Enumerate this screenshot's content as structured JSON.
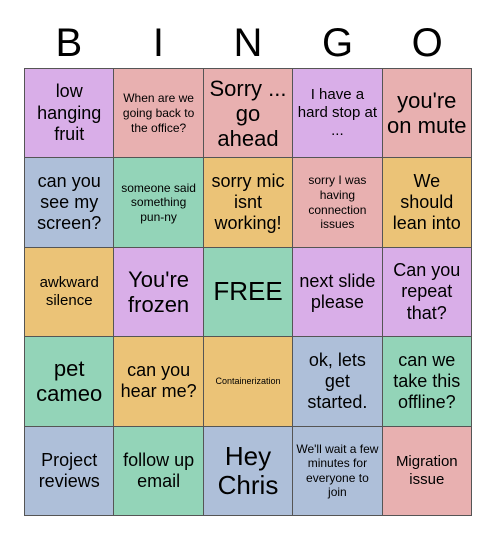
{
  "card": {
    "title_letters": [
      "B",
      "I",
      "N",
      "G",
      "O"
    ],
    "palette": {
      "purple": "#d9aee8",
      "pink": "#e8b0b0",
      "blue": "#aebfd9",
      "green": "#93d4b8",
      "orange": "#ebc377",
      "border": "#555555",
      "background": "#ffffff",
      "text": "#000000"
    },
    "columns": 5,
    "rows": 5,
    "cells": [
      {
        "text": "low hanging fruit",
        "color": "purple",
        "size": "lg"
      },
      {
        "text": "When are we going back to the office?",
        "color": "pink",
        "size": "sm"
      },
      {
        "text": "Sorry ... go ahead",
        "color": "pink",
        "size": "xl"
      },
      {
        "text": "I have a hard stop at ...",
        "color": "purple",
        "size": "md"
      },
      {
        "text": "you're on mute",
        "color": "pink",
        "size": "xl"
      },
      {
        "text": "can you see my screen?",
        "color": "blue",
        "size": "lg"
      },
      {
        "text": "someone said something pun-ny",
        "color": "green",
        "size": "sm"
      },
      {
        "text": "sorry mic isnt working!",
        "color": "orange",
        "size": "lg"
      },
      {
        "text": "sorry I was having connection issues",
        "color": "pink",
        "size": "sm"
      },
      {
        "text": "We should lean into",
        "color": "orange",
        "size": "lg"
      },
      {
        "text": "awkward silence",
        "color": "orange",
        "size": "md"
      },
      {
        "text": "You're frozen",
        "color": "purple",
        "size": "xl"
      },
      {
        "text": "FREE",
        "color": "green",
        "size": "xxl"
      },
      {
        "text": "next slide please",
        "color": "purple",
        "size": "lg"
      },
      {
        "text": "Can you repeat that?",
        "color": "purple",
        "size": "lg"
      },
      {
        "text": "pet cameo",
        "color": "green",
        "size": "xl"
      },
      {
        "text": "can you hear me?",
        "color": "orange",
        "size": "lg"
      },
      {
        "text": "Containerization",
        "color": "orange",
        "size": "xs"
      },
      {
        "text": "ok, lets get started.",
        "color": "blue",
        "size": "lg"
      },
      {
        "text": "can we take this offline?",
        "color": "green",
        "size": "lg"
      },
      {
        "text": "Project reviews",
        "color": "blue",
        "size": "lg"
      },
      {
        "text": "follow up email",
        "color": "green",
        "size": "lg"
      },
      {
        "text": "Hey Chris",
        "color": "blue",
        "size": "xxl"
      },
      {
        "text": "We'll wait a few minutes for everyone to join",
        "color": "blue",
        "size": "sm"
      },
      {
        "text": "Migration issue",
        "color": "pink",
        "size": "md"
      }
    ]
  }
}
